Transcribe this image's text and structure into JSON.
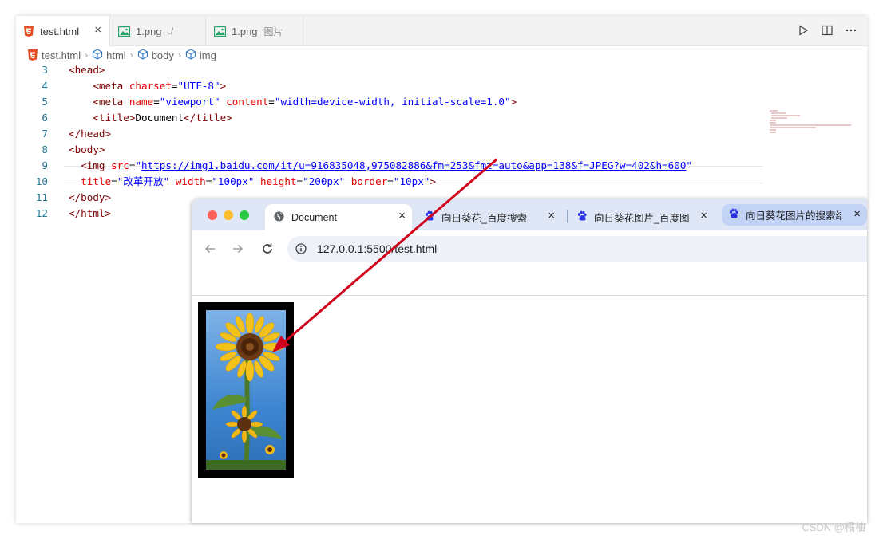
{
  "editor": {
    "tabs": [
      {
        "label": "test.html",
        "hint": "",
        "close": "×"
      },
      {
        "label": "1.png",
        "hint": "./",
        "close": ""
      },
      {
        "label": "1.png",
        "hint": "图片",
        "close": ""
      }
    ],
    "breadcrumb": [
      "test.html",
      "html",
      "body",
      "img"
    ],
    "lines": [
      {
        "num": "3",
        "segs": [
          [
            "tag",
            "<head>"
          ]
        ]
      },
      {
        "num": "4",
        "segs": [
          [
            "plain",
            "    "
          ],
          [
            "tag",
            "<meta "
          ],
          [
            "attr",
            "charset"
          ],
          [
            "plain",
            "="
          ],
          [
            "val",
            "\"UTF-8\""
          ],
          [
            "tag",
            ">"
          ]
        ]
      },
      {
        "num": "5",
        "segs": [
          [
            "plain",
            "    "
          ],
          [
            "tag",
            "<meta "
          ],
          [
            "attr",
            "name"
          ],
          [
            "plain",
            "="
          ],
          [
            "val",
            "\"viewport\""
          ],
          [
            "plain",
            " "
          ],
          [
            "attr",
            "content"
          ],
          [
            "plain",
            "="
          ],
          [
            "val",
            "\"width=device-width, initial-scale=1.0\""
          ],
          [
            "tag",
            ">"
          ]
        ]
      },
      {
        "num": "6",
        "segs": [
          [
            "plain",
            "    "
          ],
          [
            "tag",
            "<title>"
          ],
          [
            "plain",
            "Document"
          ],
          [
            "tag",
            "</title>"
          ]
        ]
      },
      {
        "num": "7",
        "segs": [
          [
            "tag",
            "</head>"
          ]
        ]
      },
      {
        "num": "8",
        "segs": [
          [
            "tag",
            "<body>"
          ]
        ]
      },
      {
        "num": "9",
        "segs": [
          [
            "plain",
            "  "
          ],
          [
            "tag",
            "<img "
          ],
          [
            "attr",
            "src"
          ],
          [
            "plain",
            "="
          ],
          [
            "val",
            "\""
          ],
          [
            "link",
            "https://img1.baidu.com/it/u=916835048,975082886&fm=253&fmt=auto&app=138&f=JPEG?w=402&h=600"
          ],
          [
            "val",
            "\""
          ]
        ]
      },
      {
        "num": "10",
        "segs": [
          [
            "plain",
            "  "
          ],
          [
            "attr",
            "title"
          ],
          [
            "plain",
            "="
          ],
          [
            "val",
            "\"改革开放\""
          ],
          [
            "plain",
            " "
          ],
          [
            "attr",
            "width"
          ],
          [
            "plain",
            "="
          ],
          [
            "val",
            "\"100px\""
          ],
          [
            "plain",
            " "
          ],
          [
            "attr",
            "height"
          ],
          [
            "plain",
            "="
          ],
          [
            "val",
            "\"200px\""
          ],
          [
            "plain",
            " "
          ],
          [
            "attr",
            "border"
          ],
          [
            "plain",
            "="
          ],
          [
            "val",
            "\"10px\""
          ],
          [
            "tag",
            ">"
          ]
        ]
      },
      {
        "num": "11",
        "segs": [
          [
            "tag",
            "</body>"
          ]
        ]
      },
      {
        "num": "12",
        "segs": [
          [
            "tag",
            "</html>"
          ]
        ]
      }
    ]
  },
  "browser": {
    "tabs": [
      {
        "title": "Document",
        "icon": "globe-icon"
      },
      {
        "title": "向日葵花_百度搜索",
        "icon": "baidu-paw-icon"
      },
      {
        "title": "向日葵花图片_百度图片",
        "icon": "baidu-paw-icon"
      },
      {
        "title": "向日葵花图片的搜索结果",
        "icon": "baidu-paw-icon"
      }
    ],
    "close_glyph": "×",
    "url": "127.0.0.1:5500/test.html"
  },
  "watermark": "CSDN @橘柚",
  "colors": {
    "tag": "#800000",
    "attr": "#e50000",
    "value": "#0000ff",
    "line_number": "#237893",
    "arrow": "#d0021b",
    "browser_tabbar": "#dfe7f7"
  }
}
